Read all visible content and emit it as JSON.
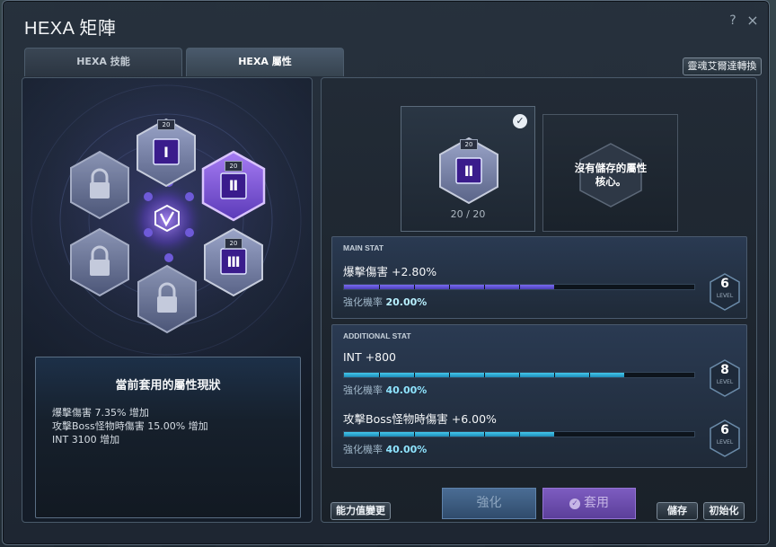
{
  "window": {
    "title": "HEXA 矩陣",
    "help_label": "?",
    "close_label": "×"
  },
  "tabs": [
    {
      "label": "HEXA 技能",
      "active": false
    },
    {
      "label": "HEXA 屬性",
      "active": true
    }
  ],
  "toolbar": {
    "convert_label": "靈魂艾爾達轉換"
  },
  "hexa_grid": {
    "center_icon": "hexa-v-emblem-icon",
    "slots": [
      {
        "id": "I",
        "numeral": "Ⅰ",
        "level": "20",
        "state": "unlocked"
      },
      {
        "id": "II",
        "numeral": "Ⅱ",
        "level": "20",
        "state": "selected"
      },
      {
        "id": "III",
        "numeral": "Ⅲ",
        "level": "20",
        "state": "unlocked"
      },
      {
        "id": "lock-1",
        "state": "locked"
      },
      {
        "id": "lock-2",
        "state": "locked"
      },
      {
        "id": "lock-3",
        "state": "locked"
      }
    ]
  },
  "current_status": {
    "title": "當前套用的屬性現狀",
    "lines": [
      "爆擊傷害 7.35% 增加",
      "攻擊Boss怪物時傷害 15.00% 增加",
      "INT 3100 增加"
    ]
  },
  "core": {
    "numeral": "Ⅱ",
    "level": "20",
    "count_text": "20 / 20",
    "empty_text": "沒有儲存的屬性核心。"
  },
  "main_stat": {
    "label": "MAIN STAT",
    "name": "爆擊傷害 +2.80%",
    "rate_label": "強化機率",
    "rate_value": "20.00%",
    "level": "6",
    "level_label": "LEVEL",
    "progress": 0.6
  },
  "additional_stat": {
    "label": "ADDITIONAL STAT",
    "items": [
      {
        "name": "INT +800",
        "rate_label": "強化機率",
        "rate_value": "40.00%",
        "level": "8",
        "level_label": "LEVEL",
        "progress": 0.8
      },
      {
        "name": "攻擊Boss怪物時傷害 +6.00%",
        "rate_label": "強化機率",
        "rate_value": "40.00%",
        "level": "6",
        "level_label": "LEVEL",
        "progress": 0.6
      }
    ]
  },
  "buttons": {
    "change_stat": "能力值變更",
    "enhance": "強化",
    "apply": "套用",
    "apply_icon": "check-circle-icon",
    "save": "儲存",
    "reset": "初始化"
  },
  "colors": {
    "accent_purple": "#7a6cf0",
    "accent_cyan": "#44c8ec",
    "selected_hex": "#8a5cf0"
  }
}
